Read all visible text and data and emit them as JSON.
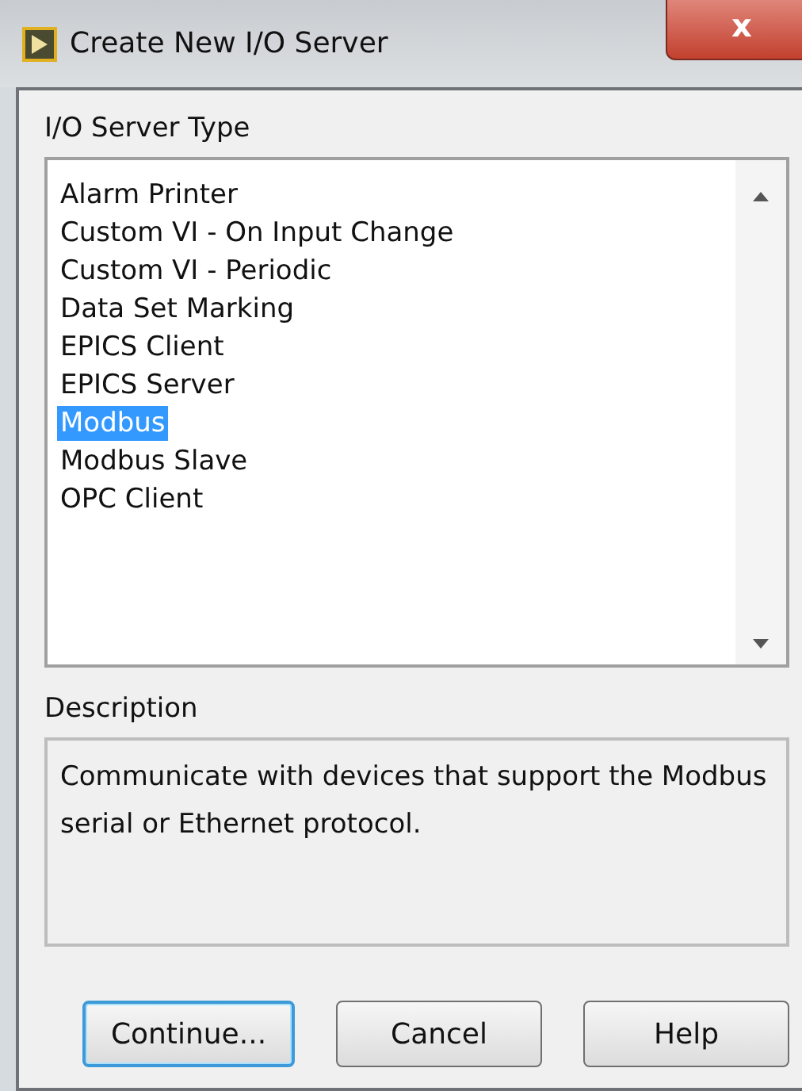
{
  "window": {
    "title": "Create New I/O Server",
    "close_symbol": "x"
  },
  "server_type": {
    "label": "I/O Server Type",
    "items": [
      {
        "label": "Alarm Printer",
        "selected": false
      },
      {
        "label": "Custom VI - On Input Change",
        "selected": false
      },
      {
        "label": "Custom VI - Periodic",
        "selected": false
      },
      {
        "label": "Data Set Marking",
        "selected": false
      },
      {
        "label": "EPICS Client",
        "selected": false
      },
      {
        "label": "EPICS Server",
        "selected": false
      },
      {
        "label": "Modbus",
        "selected": true
      },
      {
        "label": "Modbus Slave",
        "selected": false
      },
      {
        "label": "OPC Client",
        "selected": false
      }
    ]
  },
  "description": {
    "label": "Description",
    "text": "Communicate with devices that support the Modbus serial or Ethernet protocol."
  },
  "buttons": [
    {
      "label": "Continue...",
      "default": true
    },
    {
      "label": "Cancel",
      "default": false
    },
    {
      "label": "Help",
      "default": false
    }
  ]
}
